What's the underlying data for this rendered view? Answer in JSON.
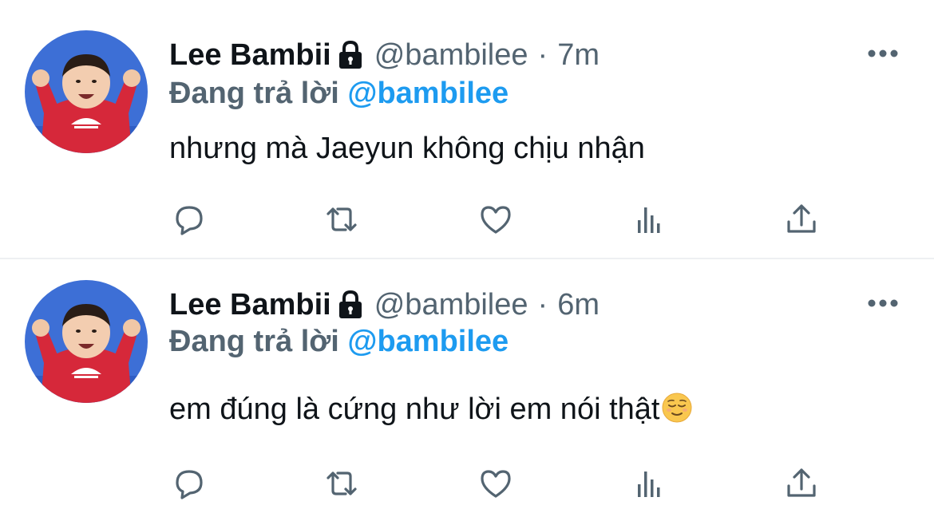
{
  "colors": {
    "text_primary": "#0f1419",
    "text_secondary": "#536471",
    "accent": "#1d9bf0",
    "divider": "#eef0f2"
  },
  "tweets": [
    {
      "display_name": "Lee Bambii",
      "handle": "@bambilee",
      "separator": "·",
      "time": "7m",
      "reply_prefix": "Đang trả lời",
      "reply_to": "@bambilee",
      "text": "nhưng mà Jaeyun không chịu nhận",
      "icons": [
        "avatar",
        "lock-icon",
        "more-icon",
        "reply-icon",
        "retweet-icon",
        "like-icon",
        "stats-icon",
        "share-icon"
      ]
    },
    {
      "display_name": "Lee Bambii",
      "handle": "@bambilee",
      "separator": "·",
      "time": "6m",
      "reply_prefix": "Đang trả lời",
      "reply_to": "@bambilee",
      "text": "em đúng là cứng như lời em nói thật",
      "emoji": "relieved-face-emoji",
      "icons": [
        "avatar",
        "lock-icon",
        "more-icon",
        "reply-icon",
        "retweet-icon",
        "like-icon",
        "stats-icon",
        "share-icon"
      ]
    }
  ]
}
